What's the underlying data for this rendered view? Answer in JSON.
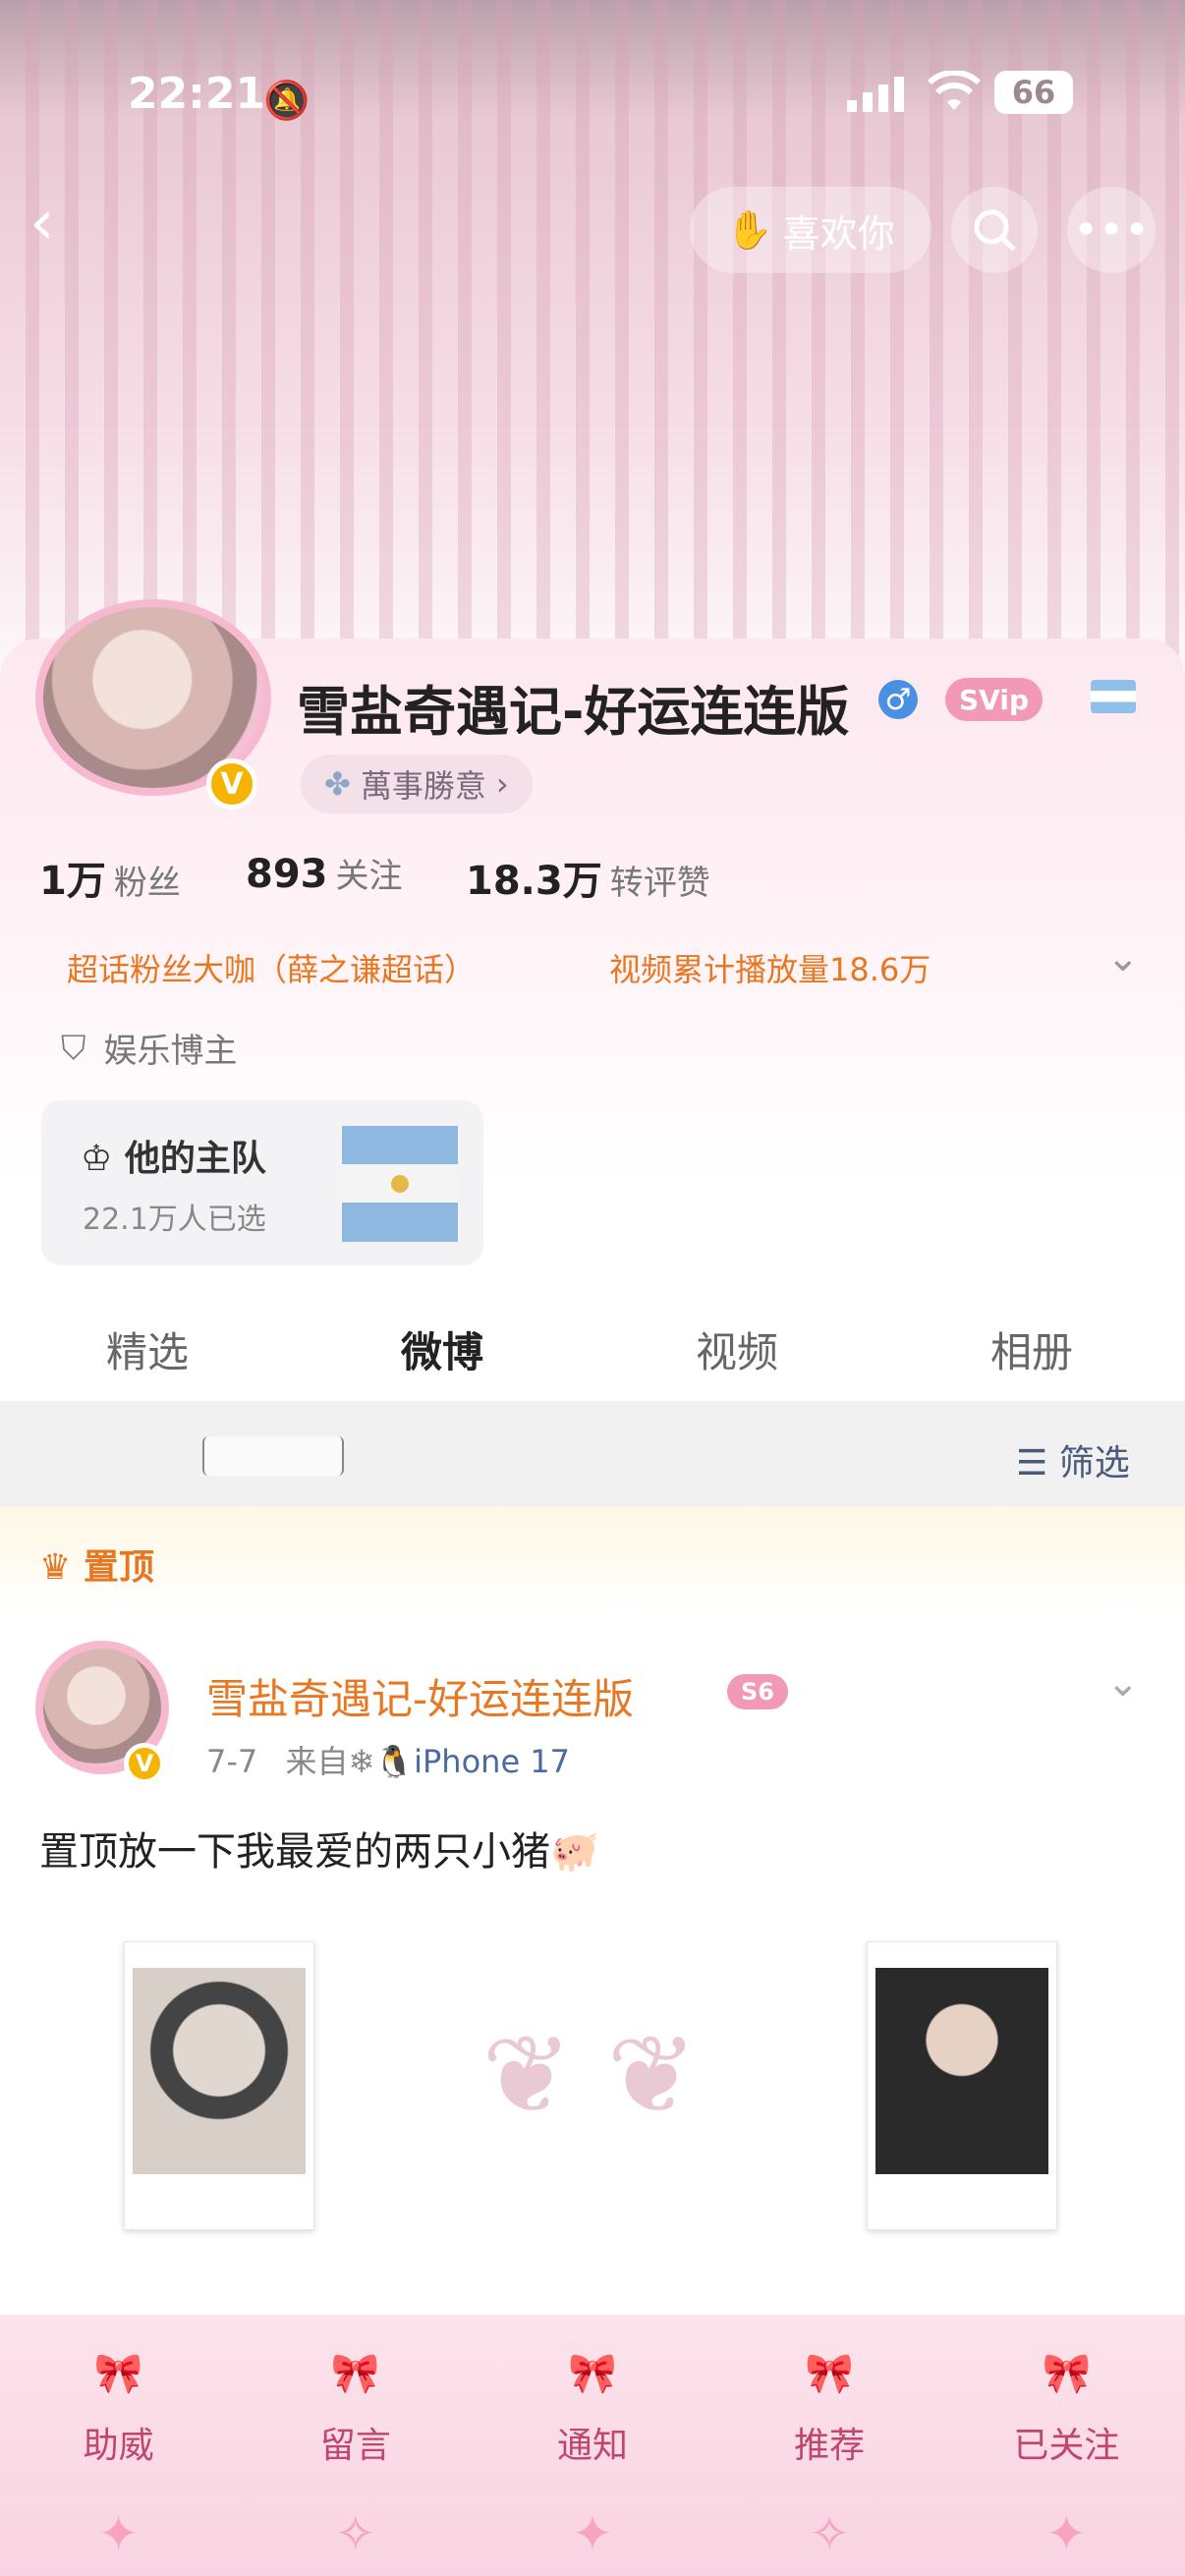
{
  "status_bar": {
    "time": "22:21",
    "battery": "66"
  },
  "top_bar": {
    "like_label": "喜欢你"
  },
  "profile": {
    "name": "雪盐奇遇记-好运连连版",
    "gender": "♂",
    "vip_badge": "SVip",
    "signature": "萬事勝意",
    "followers_num": "1万",
    "followers_label": "粉丝",
    "following_num": "893",
    "following_label": "关注",
    "likes_num": "18.3万",
    "likes_label": "转评赞",
    "tag1": "超话粉丝大咖（薛之谦超话）",
    "tag2": "视频累计播放量18.6万",
    "role": "娱乐博主",
    "team_title": "他的主队",
    "team_count": "22.1万人已选"
  },
  "tabs": [
    "精选",
    "微博",
    "视频",
    "相册"
  ],
  "filter": {
    "label": "筛选"
  },
  "pinned": {
    "label": "置顶"
  },
  "post": {
    "author": "雪盐奇遇记-好运连连版",
    "level": "S6",
    "date": "7-7",
    "source_prefix": "来自",
    "source": "iPhone 17",
    "text": "置顶放一下我最爱的两只小猪🐖"
  },
  "bottom_nav": [
    "助威",
    "留言",
    "通知",
    "推荐",
    "已关注"
  ],
  "colors": {
    "accent_orange": "#e87722",
    "pink": "#f7b9d0",
    "blue_verified": "#4a90e2"
  }
}
